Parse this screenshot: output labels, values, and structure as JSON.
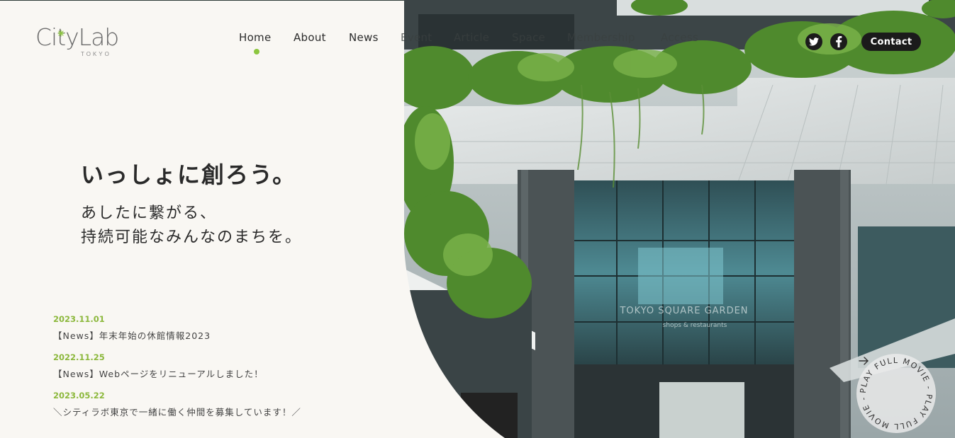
{
  "logo": {
    "main": "CityLab",
    "sub": "TOKYO"
  },
  "nav": {
    "items": [
      {
        "label": "Home",
        "active": true
      },
      {
        "label": "About"
      },
      {
        "label": "News"
      },
      {
        "label": "Event"
      },
      {
        "label": "Article"
      },
      {
        "label": "Space"
      },
      {
        "label": "Membership"
      },
      {
        "label": "Access"
      }
    ]
  },
  "social": {
    "twitter": "twitter-icon",
    "facebook": "facebook-icon"
  },
  "header": {
    "contact_label": "Contact"
  },
  "hero": {
    "title": "いっしょに創ろう。",
    "subtitle_line1": "あしたに繋がる、",
    "subtitle_line2": "持続可能なみんなのまちを。"
  },
  "news": [
    {
      "date": "2023.11.01",
      "title": "【News】年末年始の休館情報2023"
    },
    {
      "date": "2022.11.25",
      "title": "【News】Webページをリニューアルしました！"
    },
    {
      "date": "2023.05.22",
      "title": "＼シティラボ東京で一緒に働く仲間を募集しています！／"
    }
  ],
  "play": {
    "label": "PLAY FULL MOVIE - PLAY FULL MOVIE - "
  },
  "photo": {
    "signage": "TOKYO SQUARE GARDEN",
    "signage_sub": "shops & restaurants"
  },
  "colors": {
    "accent": "#8cc63f",
    "cream": "#f9f7f3",
    "dark": "#1b1b1b"
  }
}
